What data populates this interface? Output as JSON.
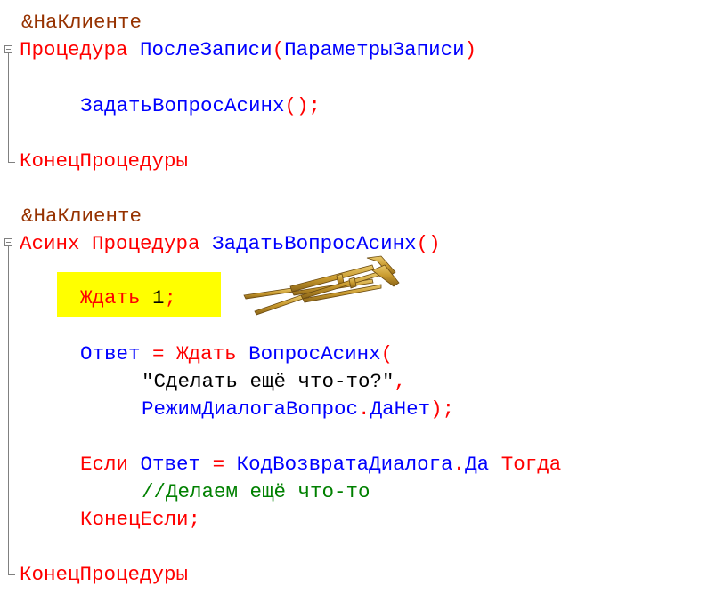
{
  "code": {
    "block1": {
      "directive": "&НаКлиенте",
      "proc_keyword": "Процедура",
      "proc_name": "ПослеЗаписи",
      "open_paren": "(",
      "param": "ПараметрыЗаписи",
      "close_paren": ")",
      "call_name": "ЗадатьВопросАсинх",
      "call_parens": "();",
      "end_keyword": "КонецПроцедуры"
    },
    "block2": {
      "directive": "&НаКлиенте",
      "async_keyword": "Асинх",
      "proc_keyword": "Процедура",
      "proc_name": "ЗадатьВопросАсинх",
      "proc_parens": "()",
      "wait_keyword": "Ждать",
      "wait_value": "1",
      "wait_semicolon": ";",
      "answer_var": "Ответ",
      "assign_op": "=",
      "wait_keyword2": "Ждать",
      "question_func": "ВопросАсинх",
      "question_open": "(",
      "question_text": "\"Сделать ещё что-то?\"",
      "comma": ",",
      "dialog_mode": "РежимДиалогаВопрос",
      "dot1": ".",
      "dialog_mode_value": "ДаНет",
      "question_close": ");",
      "if_keyword": "Если",
      "if_var": "Ответ",
      "if_eq": "=",
      "return_code": "КодВозвратаДиалога",
      "dot2": ".",
      "return_code_value": "Да",
      "then_keyword": "Тогда",
      "comment": "//Делаем ещё что-то",
      "endif_keyword": "КонецЕсли;",
      "end_keyword": "КонецПроцедуры"
    }
  },
  "colors": {
    "keyword": "#ff0000",
    "identifier": "#0000ff",
    "comment": "#008000",
    "directive": "#963200",
    "highlight": "#ffff00"
  },
  "icons": {
    "crutches": "crutches-icon"
  }
}
